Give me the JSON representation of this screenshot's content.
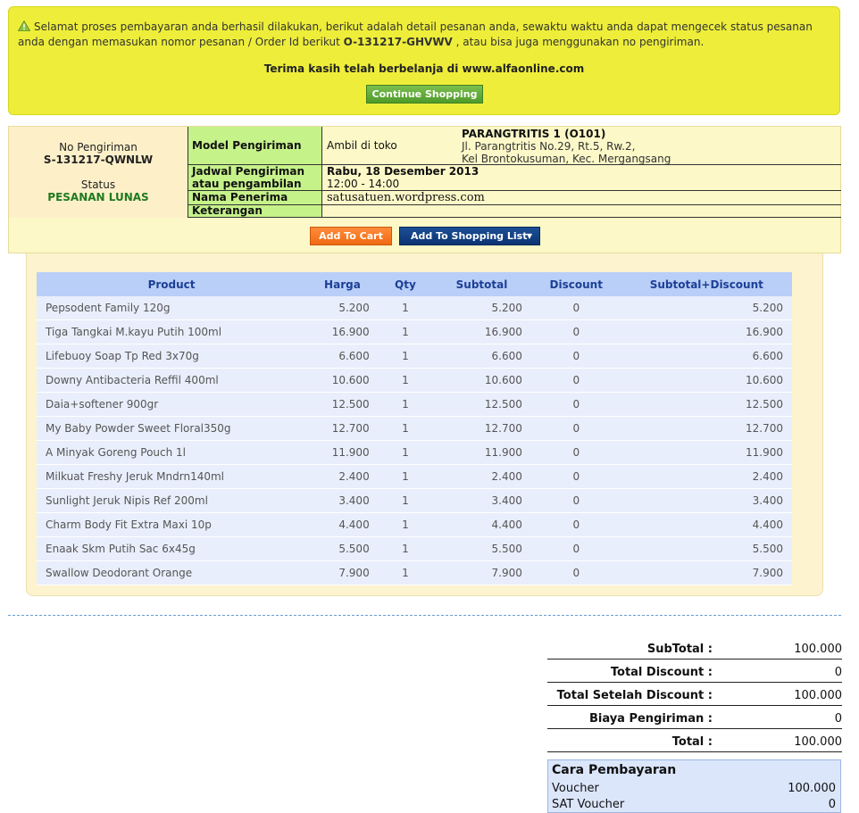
{
  "notice": {
    "message_pre": "Selamat proses pembayaran anda berhasil dilakukan, berikut adalah detail pesanan anda, sewaktu waktu anda dapat mengecek status pesanan anda dengan memasukan nomor pesanan / Order Id berikut ",
    "order_id": "O-131217-GHVWV",
    "message_post": " , atau bisa juga menggunakan no pengiriman.",
    "thanks": "Terima kasih telah berbelanja di www.alfaonline.com",
    "continue_label": "Continue Shopping",
    "icon": "warning-icon"
  },
  "shipment": {
    "no_label": "No Pengiriman",
    "no_value": "S-131217-QWNLW",
    "status_label": "Status",
    "status_value": "PESANAN LUNAS",
    "status_color": "#1f7a1f",
    "rows": {
      "model_label": "Model Pengiriman",
      "model_value": "Ambil di toko",
      "store_name": "PARANGTRITIS 1 (O101)",
      "store_addr1": "Jl. Parangtritis No.29, Rt.5, Rw.2,",
      "store_addr2": "Kel Brontokusuman, Kec. Mergangsang",
      "schedule_label1": "Jadwal Pengiriman",
      "schedule_label2": "atau pengambilan",
      "schedule_date": "Rabu, 18 Desember 2013",
      "schedule_time": "12:00 - 14:00",
      "recipient_label": "Nama Penerima",
      "recipient_value": "satusatuen.wordpress.com",
      "note_label": "Keterangan"
    },
    "add_to_cart": "Add To Cart",
    "add_to_list": "Add To Shopping List"
  },
  "products": {
    "headers": [
      "Product",
      "Harga",
      "Qty",
      "Subtotal",
      "Discount",
      "Subtotal+Discount"
    ],
    "rows": [
      [
        "Pepsodent Family 120g",
        "5.200",
        "1",
        "5.200",
        "0",
        "5.200"
      ],
      [
        "Tiga Tangkai M.kayu Putih 100ml",
        "16.900",
        "1",
        "16.900",
        "0",
        "16.900"
      ],
      [
        "Lifebuoy Soap Tp Red 3x70g",
        "6.600",
        "1",
        "6.600",
        "0",
        "6.600"
      ],
      [
        "Downy Antibacteria Reffil 400ml",
        "10.600",
        "1",
        "10.600",
        "0",
        "10.600"
      ],
      [
        "Daia+softener 900gr",
        "12.500",
        "1",
        "12.500",
        "0",
        "12.500"
      ],
      [
        "My Baby Powder Sweet Floral350g",
        "12.700",
        "1",
        "12.700",
        "0",
        "12.700"
      ],
      [
        "A Minyak Goreng Pouch 1l",
        "11.900",
        "1",
        "11.900",
        "0",
        "11.900"
      ],
      [
        "Milkuat Freshy Jeruk Mndrn140ml",
        "2.400",
        "1",
        "2.400",
        "0",
        "2.400"
      ],
      [
        "Sunlight Jeruk Nipis Ref 200ml",
        "3.400",
        "1",
        "3.400",
        "0",
        "3.400"
      ],
      [
        "Charm Body Fit Extra Maxi 10p",
        "4.400",
        "1",
        "4.400",
        "0",
        "4.400"
      ],
      [
        "Enaak Skm Putih Sac 6x45g",
        "5.500",
        "1",
        "5.500",
        "0",
        "5.500"
      ],
      [
        "Swallow Deodorant Orange",
        "7.900",
        "1",
        "7.900",
        "0",
        "7.900"
      ]
    ]
  },
  "totals": [
    {
      "label": "SubTotal :",
      "value": "100.000"
    },
    {
      "label": "Total Discount :",
      "value": "0"
    },
    {
      "label": "Total Setelah Discount :",
      "value": "100.000"
    },
    {
      "label": "Biaya Pengiriman :",
      "value": "0"
    },
    {
      "label": "Total :",
      "value": "100.000"
    }
  ],
  "payment": {
    "title": "Cara Pembayaran",
    "rows": [
      {
        "label": "Voucher",
        "value": "100.000"
      },
      {
        "label": "SAT Voucher",
        "value": "0"
      }
    ]
  }
}
